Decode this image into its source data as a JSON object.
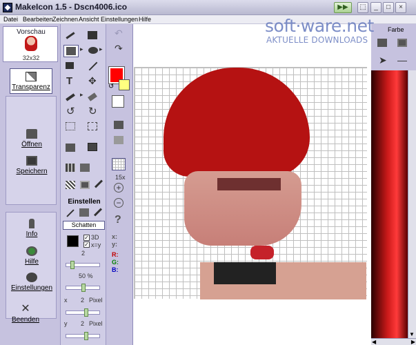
{
  "window": {
    "title": "MakeIcon 1.5 - Dscn4006.ico",
    "controls": [
      "minimize-icon",
      "maximize-icon",
      "close-icon"
    ]
  },
  "menu": [
    "Datei",
    "Bearbeiten",
    "Zeichnen",
    "Ansicht",
    "Einstellungen",
    "Hilfe"
  ],
  "watermark": {
    "brand": "soft·ware.net",
    "tagline": "AKTUELLE DOWNLOADS"
  },
  "preview": {
    "title": "Vorschau",
    "size": "32x32"
  },
  "left_panel": {
    "transparenz": "Transparenz",
    "oeffnen": "Öffnen",
    "speichern": "Speichern",
    "info": "Info",
    "hilfe": "Hilfe",
    "einstellungen": "Einstellungen",
    "beenden": "Beenden"
  },
  "tools_panel": {
    "einstellen_title": "Einstellen",
    "schatten_label": "Schatten",
    "check_3d": "3D",
    "check_xy": "x=y",
    "value_2": "2",
    "percent": "50 %",
    "x_label": "x",
    "x_value": "2",
    "x_unit": "Pixel",
    "y_label": "y",
    "y_value": "2",
    "y_unit": "Pixel"
  },
  "colors_panel": {
    "primary_color": "#ff0000",
    "secondary_color": "#ffff80",
    "background_color": "#ffffff",
    "zoom": "15x",
    "coord_x": "x:",
    "coord_y": "y:",
    "rgb_r": "R:",
    "rgb_g": "G:",
    "rgb_b": "B:"
  },
  "right_panel": {
    "farbe": "Farbe"
  }
}
